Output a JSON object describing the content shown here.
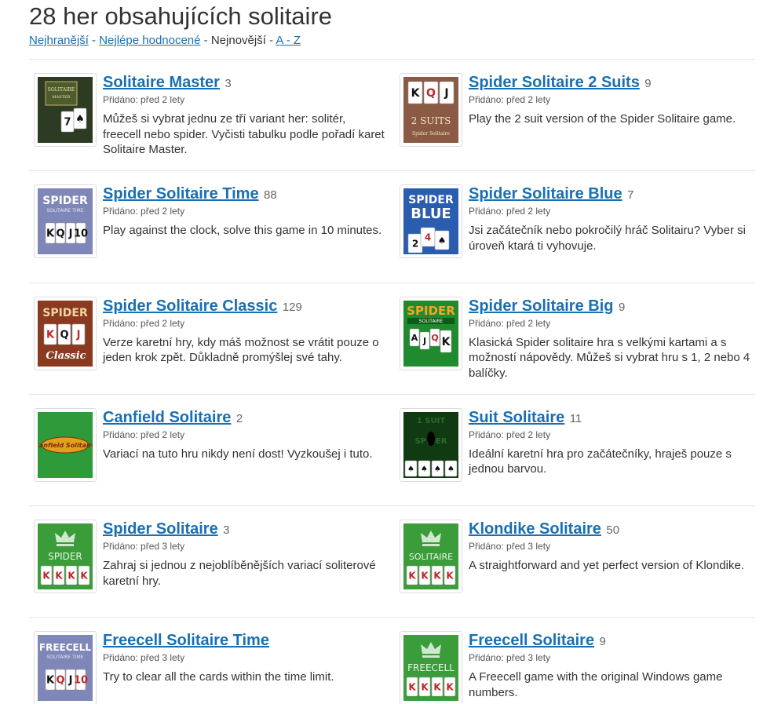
{
  "page": {
    "title": "28 her obsahujících solitaire"
  },
  "sort": {
    "options": [
      {
        "label": "Nejhranější",
        "link": true
      },
      {
        "label": "Nejlépe hodnocené",
        "link": true
      },
      {
        "label": "Nejnovější",
        "link": false
      },
      {
        "label": "A - Z",
        "link": true
      }
    ],
    "separator": "-"
  },
  "colors": {
    "link": "#1a6fb0",
    "text": "#333333",
    "green": "#3a9d3a",
    "blue": "#2a5db0",
    "lavender": "#7f86b8",
    "brown": "#8a5a44"
  },
  "games": [
    {
      "title": "Solitaire Master",
      "count": "3",
      "added": "Přidáno: před 2 lety",
      "desc": "Můžeš si vybrat jednu ze tří variant her: solitér, freecell nebo spider. Vyčisti tabulku podle pořadí karet Solitaire Master.",
      "icon": "solitaire-master-thumbnail",
      "thumb_text": [
        "SOLITAIRE",
        "MASTER"
      ]
    },
    {
      "title": "Spider Solitaire 2 Suits",
      "count": "9",
      "added": "Přidáno: před 2 lety",
      "desc": "Play the 2 suit version of the Spider Solitaire game.",
      "icon": "spider-2-suits-thumbnail",
      "thumb_text": [
        "2 SUITS",
        "Spider Solitaire"
      ]
    },
    {
      "title": "Spider Solitaire Time",
      "count": "88",
      "added": "Přidáno: před 2 lety",
      "desc": "Play against the clock, solve this game in 10 minutes.",
      "icon": "spider-time-thumbnail",
      "thumb_text": [
        "SPIDER",
        "SOLITAIRE TIME"
      ]
    },
    {
      "title": "Spider Solitaire Blue",
      "count": "7",
      "added": "Přidáno: před 2 lety",
      "desc": "Jsi začátečník nebo pokročilý hráč Solitairu? Vyber si úroveň ktará ti vyhovuje.",
      "icon": "spider-blue-thumbnail",
      "thumb_text": [
        "SPIDER",
        "BLUE"
      ]
    },
    {
      "title": "Spider Solitaire Classic",
      "count": "129",
      "added": "Přidáno: před 2 lety",
      "desc": "Verze karetní hry, kdy máš možnost se vrátit pouze o jeden krok zpět. Důkladně promýšlej své tahy.",
      "icon": "spider-classic-thumbnail",
      "thumb_text": [
        "SPIDER",
        "Classic"
      ]
    },
    {
      "title": "Spider Solitaire Big",
      "count": "9",
      "added": "Přidáno: před 2 lety",
      "desc": "Klasická Spider solitaire hra s velkými kartami a s možností nápovědy. Můžeš si vybrat hru s 1, 2 nebo 4 balíčky.",
      "icon": "spider-big-thumbnail",
      "thumb_text": [
        "SPIDER",
        "SOLITAIRE"
      ]
    },
    {
      "title": "Canfield Solitaire",
      "count": "2",
      "added": "Přidáno: před 2 lety",
      "desc": "Variací na tuto hru nikdy není dost! Vyzkoušej i tuto.",
      "icon": "canfield-thumbnail",
      "thumb_text": [
        "Canfield Solitaire"
      ]
    },
    {
      "title": "Suit Solitaire",
      "count": "11",
      "added": "Přidáno: před 2 lety",
      "desc": "Ideální karetní hra pro začátečníky, hraješ pouze s jednou barvou.",
      "icon": "suit-solitaire-thumbnail",
      "thumb_text": [
        "1 SUIT",
        "SPIDER"
      ]
    },
    {
      "title": "Spider Solitaire",
      "count": "3",
      "added": "Přidáno: před 3 lety",
      "desc": "Zahraj si jednou z nejoblíběnějších variací soliterové karetní hry.",
      "icon": "spider-crown-thumbnail",
      "thumb_text": [
        "SPIDER"
      ]
    },
    {
      "title": "Klondike Solitaire",
      "count": "50",
      "added": "Přidáno: před 3 lety",
      "desc": "A straightforward and yet perfect version of Klondike.",
      "icon": "klondike-crown-thumbnail",
      "thumb_text": [
        "SOLITAIRE"
      ]
    },
    {
      "title": "Freecell Solitaire Time",
      "count": "",
      "added": "Přidáno: před 3 lety",
      "desc": "Try to clear all the cards within the time limit.",
      "icon": "freecell-time-thumbnail",
      "thumb_text": [
        "FREECELL",
        "SOLITAIRE TIME"
      ]
    },
    {
      "title": "Freecell Solitaire",
      "count": "9",
      "added": "Přidáno: před 3 lety",
      "desc": "A Freecell game with the original Windows game numbers.",
      "icon": "freecell-crown-thumbnail",
      "thumb_text": [
        "FREECELL"
      ]
    }
  ]
}
